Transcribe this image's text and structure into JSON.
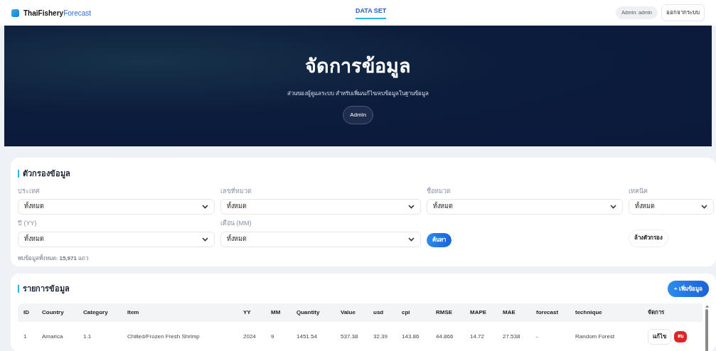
{
  "header": {
    "logo_bold": "ThaiFishery",
    "logo_light": "Forecast",
    "nav": [
      {
        "label": "DATA SET",
        "selected": true
      }
    ],
    "user_badge": "Admin: admin",
    "logout": "ออกจากระบบ"
  },
  "hero": {
    "title": "จัดการข้อมูล",
    "subtitle": "ส่วนของผู้ดูแลระบบ สำหรับเพิ่ม/แก้ไข/ลบข้อมูลในฐานข้อมูล",
    "role": "Admin"
  },
  "filters": {
    "title": "ตัวกรองข้อมูล",
    "fields": [
      {
        "label": "ประเทศ",
        "value": "ทั้งหมด"
      },
      {
        "label": "เลขที่หมวด",
        "value": "ทั้งหมด"
      },
      {
        "label": "ชื่อหมวด",
        "value": "ทั้งหมด"
      },
      {
        "label": "เทคนิค",
        "value": "ทั้งหมด"
      },
      {
        "label": "ปี (YY)",
        "value": "ทั้งหมด"
      },
      {
        "label": "เดือน (MM)",
        "value": "ทั้งหมด"
      }
    ],
    "search_button": "ค้นหา",
    "clear_button": "ล้างตัวกรอง",
    "result_count": "พบข้อมูลทั้งหมด: **15,971** แถว"
  },
  "table": {
    "title": "รายการข้อมูล",
    "add_button": "+ เพิ่มข้อมูล",
    "columns": [
      "ID",
      "Country",
      "Category",
      "Item",
      "YY",
      "MM",
      "Quantity",
      "Value",
      "usd",
      "cpi",
      "RMSE",
      "MAPE",
      "MAE",
      "forecast",
      "technique",
      "จัดการ"
    ],
    "rows": [
      {
        "cells": [
          "1",
          "Amarica",
          "1.1",
          "Chilled/Frozen Fresh Shrimp",
          "2024",
          "9",
          "1451.54",
          "537.38",
          "32.39",
          "143.86",
          "44.866",
          "14.72",
          "27.538",
          "-",
          "Random Forest"
        ],
        "actions": [
          "แก้ไข",
          "ลบ"
        ]
      }
    ]
  }
}
